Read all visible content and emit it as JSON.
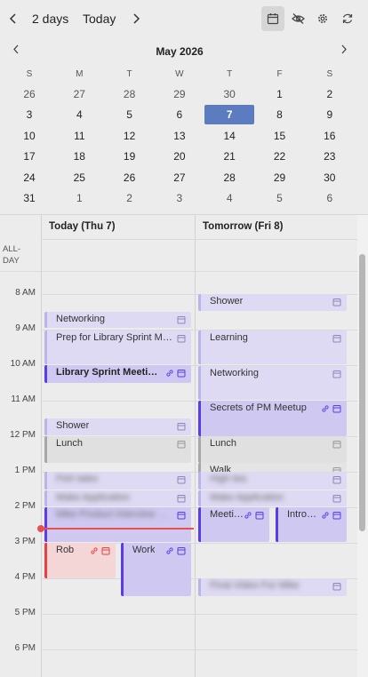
{
  "toolbar": {
    "range_label": "2 days",
    "today_label": "Today",
    "icons": [
      "chevron-left-icon",
      "chevron-right-icon",
      "calendar-icon",
      "eye-off-icon",
      "gear-icon",
      "refresh-icon"
    ]
  },
  "month": {
    "title": "May 2026",
    "weekdays": [
      "S",
      "M",
      "T",
      "W",
      "T",
      "F",
      "S"
    ],
    "weeks": [
      [
        "26",
        "27",
        "28",
        "29",
        "30",
        "1",
        "2"
      ],
      [
        "3",
        "4",
        "5",
        "6",
        "7",
        "8",
        "9"
      ],
      [
        "10",
        "11",
        "12",
        "13",
        "14",
        "15",
        "16"
      ],
      [
        "17",
        "18",
        "19",
        "20",
        "21",
        "22",
        "23"
      ],
      [
        "24",
        "25",
        "26",
        "27",
        "28",
        "29",
        "30"
      ],
      [
        "31",
        "1",
        "2",
        "3",
        "4",
        "5",
        "6"
      ]
    ],
    "today": "7"
  },
  "columns": [
    "Today (Thu 7)",
    "Tomorrow (Fri 8)"
  ],
  "allday_label": "ALL-\nDAY",
  "times": [
    "8 AM",
    "9 AM",
    "10 AM",
    "11 AM",
    "12 PM",
    "1 PM",
    "2 PM",
    "3 PM",
    "4 PM",
    "5 PM",
    "6 PM"
  ],
  "events_today": [
    {
      "title": "Networking"
    },
    {
      "title": "Prep for Library Sprint Meeting"
    },
    {
      "title": "Library Sprint Meeting"
    },
    {
      "title": "Shower"
    },
    {
      "title": "Lunch"
    },
    {
      "title": "Fish tales"
    },
    {
      "title": "Make Application"
    },
    {
      "title": "Mike Product Interview Call"
    },
    {
      "title": "Rob"
    },
    {
      "title": "Work"
    }
  ],
  "events_tomorrow": [
    {
      "title": "Shower"
    },
    {
      "title": "Learning"
    },
    {
      "title": "Networking"
    },
    {
      "title": "Secrets of PM Meetup"
    },
    {
      "title": "Lunch"
    },
    {
      "title": "Walk"
    },
    {
      "title": "High tea"
    },
    {
      "title": "Make Application"
    },
    {
      "title": "Meeting"
    },
    {
      "title": "Intro call"
    },
    {
      "title": "Final Video For Mike"
    }
  ],
  "colors": {
    "accent": "#5a3de8",
    "today_highlight": "#5d7cbf",
    "now_line": "#e85050"
  }
}
